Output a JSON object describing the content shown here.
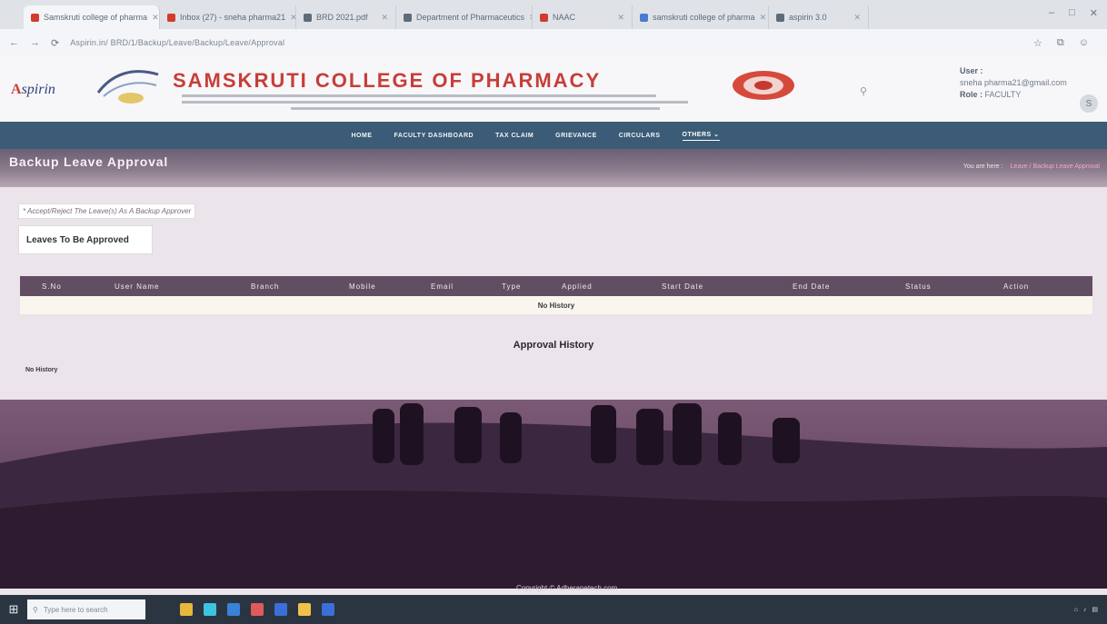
{
  "browser": {
    "tabs": [
      {
        "title": "Samskruti college of pharma",
        "favicon_color": "#d33b2f"
      },
      {
        "title": "Inbox (27) - sneha pharma21",
        "favicon_color": "#d33b2f"
      },
      {
        "title": "BRD 2021.pdf",
        "favicon_color": "#5e6b7a"
      },
      {
        "title": "Department of Pharmaceutics",
        "favicon_color": "#5e6b7a"
      },
      {
        "title": "NAAC",
        "favicon_color": "#d33b2f"
      },
      {
        "title": "samskruti college of pharma",
        "favicon_color": "#4a7bd0"
      },
      {
        "title": "aspirin 3.0",
        "favicon_color": "#5e6b7a"
      }
    ],
    "url": "Aspirin.in/   BRD/1/Backup/Leave/Backup/Leave/Approval"
  },
  "header": {
    "brand": "Aspirin",
    "college_name": "SAMSKRUTI COLLEGE OF PHARMACY",
    "user_label": "User :",
    "user_email": "sneha pharma21@gmail.com",
    "role_label": "Role :",
    "role_value": "FACULTY",
    "avatar_initial": "S"
  },
  "nav": {
    "items": [
      "HOME",
      "FACULTY DASHBOARD",
      "TAX CLAIM",
      "GRIEVANCE",
      "CIRCULARS",
      "OTHERS ⌄"
    ]
  },
  "page": {
    "title": "Backup Leave Approval",
    "breadcrumb_prefix": "You are here :",
    "breadcrumb_current": "Leave / Backup Leave Approval",
    "note": "* Accept/Reject The Leave(s) As A Backup Approver",
    "section_button": "Leaves To Be Approved",
    "table": {
      "columns": [
        "S.No",
        "User Name",
        "Branch",
        "Mobile",
        "Email",
        "Type",
        "Applied",
        "Start Date",
        "End Date",
        "Status",
        "Action"
      ],
      "empty_text": "No History"
    },
    "approval_title": "Approval History",
    "approval_empty": "No History"
  },
  "footer": {
    "copyright": "Copyright © Adheranetech.com"
  },
  "taskbar": {
    "search_placeholder": "Type here to search",
    "app_colors": [
      "#e8b83a",
      "#3ec4e0",
      "#3a82d8",
      "#e05a5a",
      "#3a6fd8",
      "#f0c24a",
      "#3a6fd8"
    ]
  }
}
